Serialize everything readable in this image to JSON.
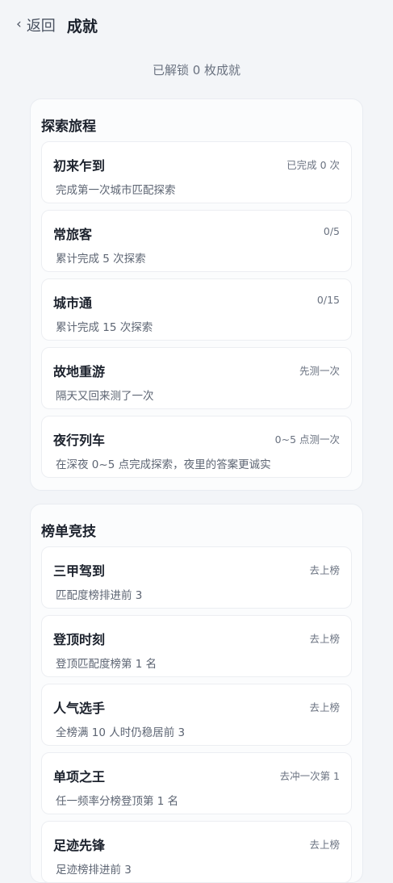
{
  "header": {
    "back_label": "返回",
    "title": "成就"
  },
  "summary": "已解锁 0 枚成就",
  "sections": [
    {
      "title": "探索旅程",
      "items": [
        {
          "name": "初来乍到",
          "desc": "完成第一次城市匹配探索",
          "status": "已完成 0 次"
        },
        {
          "name": "常旅客",
          "desc": "累计完成 5 次探索",
          "status": "0/5"
        },
        {
          "name": "城市通",
          "desc": "累计完成 15 次探索",
          "status": "0/15"
        },
        {
          "name": "故地重游",
          "desc": "隔天又回来测了一次",
          "status": "先测一次"
        },
        {
          "name": "夜行列车",
          "desc": "在深夜 0~5 点完成探索，夜里的答案更诚实",
          "status": "0~5 点测一次"
        }
      ]
    },
    {
      "title": "榜单竞技",
      "items": [
        {
          "name": "三甲驾到",
          "desc": "匹配度榜排进前 3",
          "status": "去上榜"
        },
        {
          "name": "登顶时刻",
          "desc": "登顶匹配度榜第 1 名",
          "status": "去上榜"
        },
        {
          "name": "人气选手",
          "desc": "全榜满 10 人时仍稳居前 3",
          "status": "去上榜"
        },
        {
          "name": "单项之王",
          "desc": "任一频率分榜登顶第 1 名",
          "status": "去冲一次第 1"
        },
        {
          "name": "足迹先锋",
          "desc": "足迹榜排进前 3",
          "status": "去上榜"
        }
      ]
    }
  ]
}
